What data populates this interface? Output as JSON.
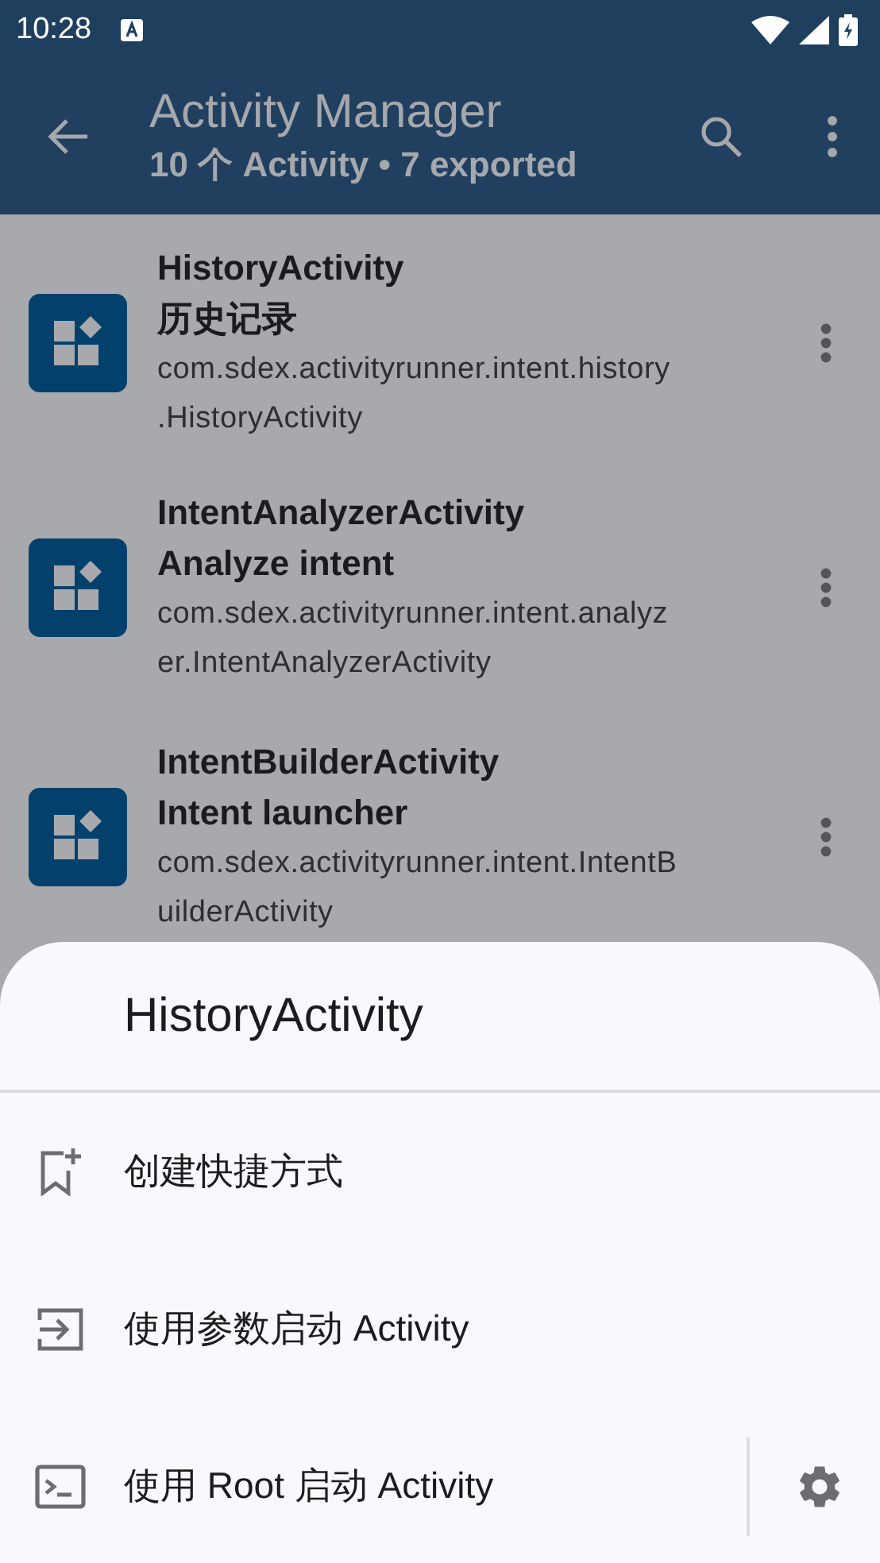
{
  "status_bar": {
    "time": "10:28"
  },
  "app_bar": {
    "title": "Activity Manager",
    "subtitle": "10 个 Activity • 7 exported"
  },
  "activities": [
    {
      "name": "HistoryActivity",
      "label": "历史记录",
      "package_lines": [
        "com.sdex.activityrunner.intent.history",
        ".HistoryActivity"
      ]
    },
    {
      "name": "IntentAnalyzerActivity",
      "label": "Analyze intent",
      "package_lines": [
        "com.sdex.activityrunner.intent.analyz",
        "er.IntentAnalyzerActivity"
      ]
    },
    {
      "name": "IntentBuilderActivity",
      "label": "Intent launcher",
      "package_lines": [
        "com.sdex.activityrunner.intent.IntentB",
        "uilderActivity"
      ]
    }
  ],
  "bottom_sheet": {
    "title": "HistoryActivity",
    "actions": [
      {
        "kind": "shortcut",
        "label": "创建快捷方式"
      },
      {
        "kind": "params",
        "label": "使用参数启动 Activity"
      },
      {
        "kind": "root",
        "label": "使用 Root 启动 Activity"
      }
    ]
  }
}
